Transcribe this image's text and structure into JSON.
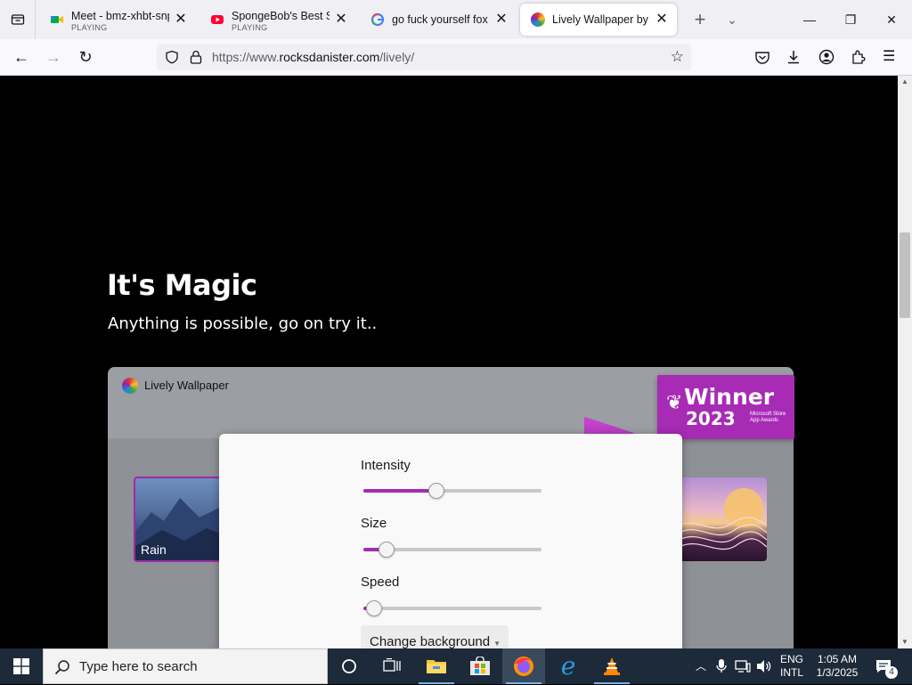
{
  "browser": {
    "tabs": [
      {
        "title": "Meet - bmz-xhbt-snp",
        "status": "PLAYING",
        "icon": "google-meet-icon",
        "active": false
      },
      {
        "title": "SpongeBob's Best Songs",
        "status": "PLAYING",
        "icon": "youtube-icon",
        "active": false
      },
      {
        "title": "go fuck yourself fox - G",
        "status": "",
        "icon": "google-icon",
        "active": false
      },
      {
        "title": "Lively Wallpaper by rocks",
        "status": "",
        "icon": "lively-icon",
        "active": true
      }
    ],
    "url": {
      "prefix": "https://www.",
      "host": "rocksdanister.com",
      "path": "/lively/"
    }
  },
  "page": {
    "title": "It's Magic",
    "subtitle": "Anything is possible, go on try it..",
    "demo": {
      "app_name": "Lively Wallpaper",
      "thumb_rain_label": "Rain",
      "badge": {
        "winner": "Winner",
        "year": "2023",
        "small": "Microsoft Store App Awards"
      },
      "controls": {
        "sliders": [
          {
            "label": "Intensity",
            "value": 0.41
          },
          {
            "label": "Size",
            "value": 0.13
          },
          {
            "label": "Speed",
            "value": 0.06
          }
        ],
        "change_background_label": "Change background"
      }
    }
  },
  "taskbar": {
    "search_placeholder": "Type here to search",
    "language": "ENG",
    "layout": "INTL",
    "time": "1:05 AM",
    "date": "1/3/2025",
    "notifications": "4"
  },
  "colors": {
    "accent": "#a32db0",
    "taskbar": "#1c2a3a",
    "page_bg": "#000000"
  }
}
